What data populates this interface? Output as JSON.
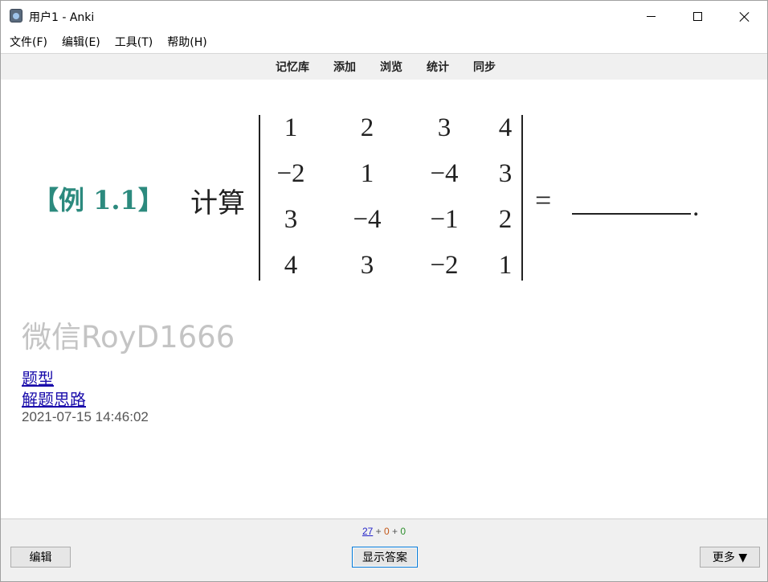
{
  "window": {
    "title": "用户1 - Anki",
    "icon": "anki-app-icon"
  },
  "menu": [
    "文件(F)",
    "编辑(E)",
    "工具(T)",
    "帮助(H)"
  ],
  "toolbar": [
    "记忆库",
    "添加",
    "浏览",
    "统计",
    "同步"
  ],
  "card": {
    "example_label": "【例 1.1】",
    "calc_label": "计算",
    "matrix": [
      [
        "1",
        "2",
        "3",
        "4"
      ],
      [
        "−2",
        "1",
        "−4",
        "3"
      ],
      [
        "3",
        "−4",
        "−1",
        "2"
      ],
      [
        "4",
        "3",
        "−2",
        "1"
      ]
    ],
    "equals": "=",
    "period": ".",
    "watermark": "微信RoyD1666",
    "links": [
      "题型",
      "解题思路"
    ],
    "timestamp": "2021-07-15 14:46:02"
  },
  "bottom": {
    "count_new": "27",
    "count_sep1": " + ",
    "count_learn": "0",
    "count_sep2": " + ",
    "count_review": "0",
    "edit_button": "编辑",
    "show_answer_button": "显示答案",
    "more_button": "更多 ▼"
  },
  "colors": {
    "example_label": "#2c8a7e",
    "link": "#1a0dab",
    "watermark": "#c4c4c4",
    "count_new": "#2323c8",
    "count_learn": "#c35617",
    "count_review": "#2d8f2d"
  }
}
